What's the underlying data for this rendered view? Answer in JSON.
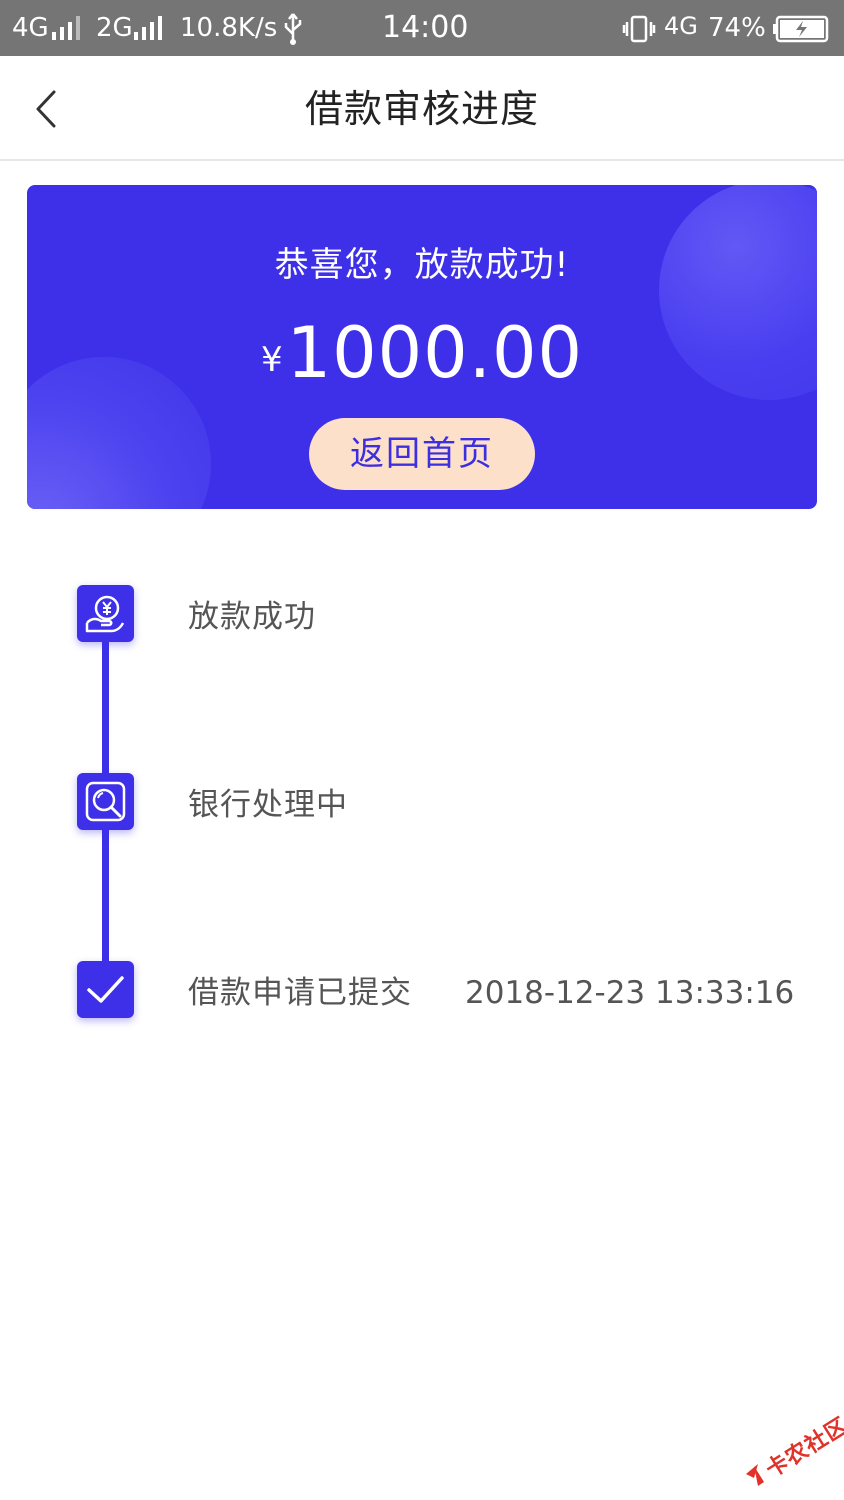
{
  "status_bar": {
    "network1": "4G",
    "network2": "2G",
    "speed": "10.8K/s",
    "time": "14:00",
    "network3": "4G",
    "battery": "74%"
  },
  "nav": {
    "title": "借款审核进度"
  },
  "banner": {
    "congrats": "恭喜您，放款成功!",
    "currency": "¥",
    "amount": "1000.00",
    "home_button": "返回首页"
  },
  "timeline": [
    {
      "label": "放款成功",
      "time": "",
      "icon": "money-hand-icon"
    },
    {
      "label": "银行处理中",
      "time": "",
      "icon": "search-icon"
    },
    {
      "label": "借款申请已提交",
      "time": "2018-12-23 13:33:16",
      "icon": "check-icon"
    }
  ],
  "watermark": {
    "text": "卡农社区"
  },
  "colors": {
    "primary": "#3d30e8",
    "button_bg": "#fde0c9",
    "status_bar_bg": "#757575"
  }
}
